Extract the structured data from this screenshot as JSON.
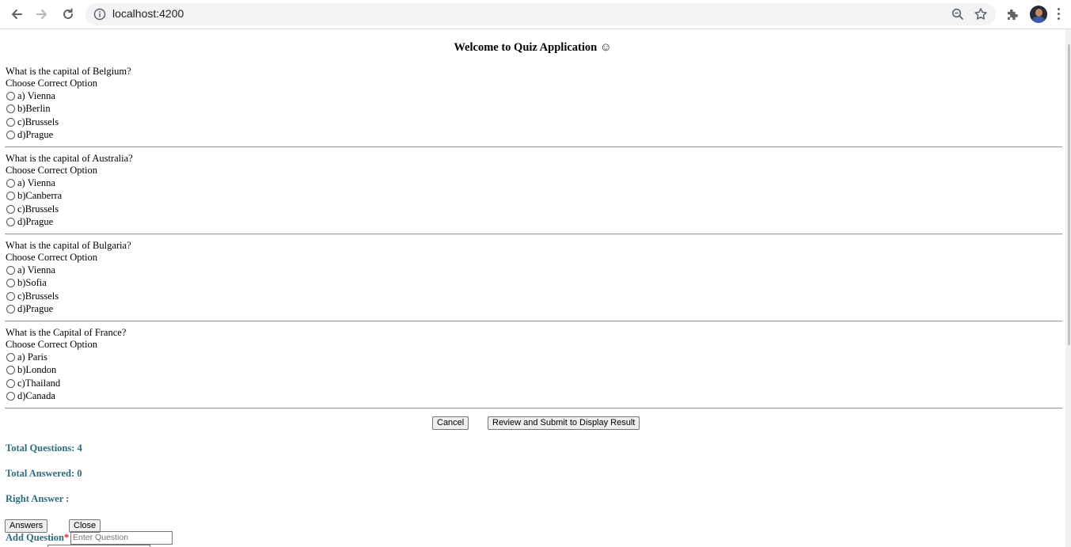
{
  "browser": {
    "url": "localhost:4200",
    "icons": [
      "back-arrow-icon",
      "forward-arrow-icon",
      "reload-icon",
      "info-icon",
      "zoom-icon",
      "star-icon",
      "extensions-icon",
      "avatar",
      "menu-dots-icon"
    ]
  },
  "page": {
    "title": "Welcome to Quiz Application ☺"
  },
  "questions": [
    {
      "text": "What is the capital of Belgium?",
      "prompt": "Choose Correct Option",
      "options": [
        "a) Vienna",
        "b)Berlin",
        "c)Brussels",
        "d)Prague"
      ]
    },
    {
      "text": "What is the capital of Australia?",
      "prompt": "Choose Correct Option",
      "options": [
        "a) Vienna",
        "b)Canberra",
        "c)Brussels",
        "d)Prague"
      ]
    },
    {
      "text": "What is the capital of Bulgaria?",
      "prompt": "Choose Correct Option",
      "options": [
        "a) Vienna",
        "b)Sofia",
        "c)Brussels",
        "d)Prague"
      ]
    },
    {
      "text": "What is the Capital of France?",
      "prompt": "Choose Correct Option",
      "options": [
        "a) Paris",
        "b)London",
        "c)Thailand",
        "d)Canada"
      ]
    }
  ],
  "actions": {
    "cancel_label": "Cancel",
    "submit_label": "Review and Submit to Display Result"
  },
  "stats": {
    "total_questions": "Total Questions: 4",
    "total_answered": "Total Answered: 0",
    "right_answer": "Right Answer :"
  },
  "footer_buttons": {
    "answers_label": "Answers",
    "close_label": "Close"
  },
  "add_question": {
    "label": "Add Question",
    "required_mark": "*",
    "placeholder": "Enter Question"
  },
  "colors": {
    "stat_text": "#2e6b7c",
    "required": "#e02020"
  }
}
